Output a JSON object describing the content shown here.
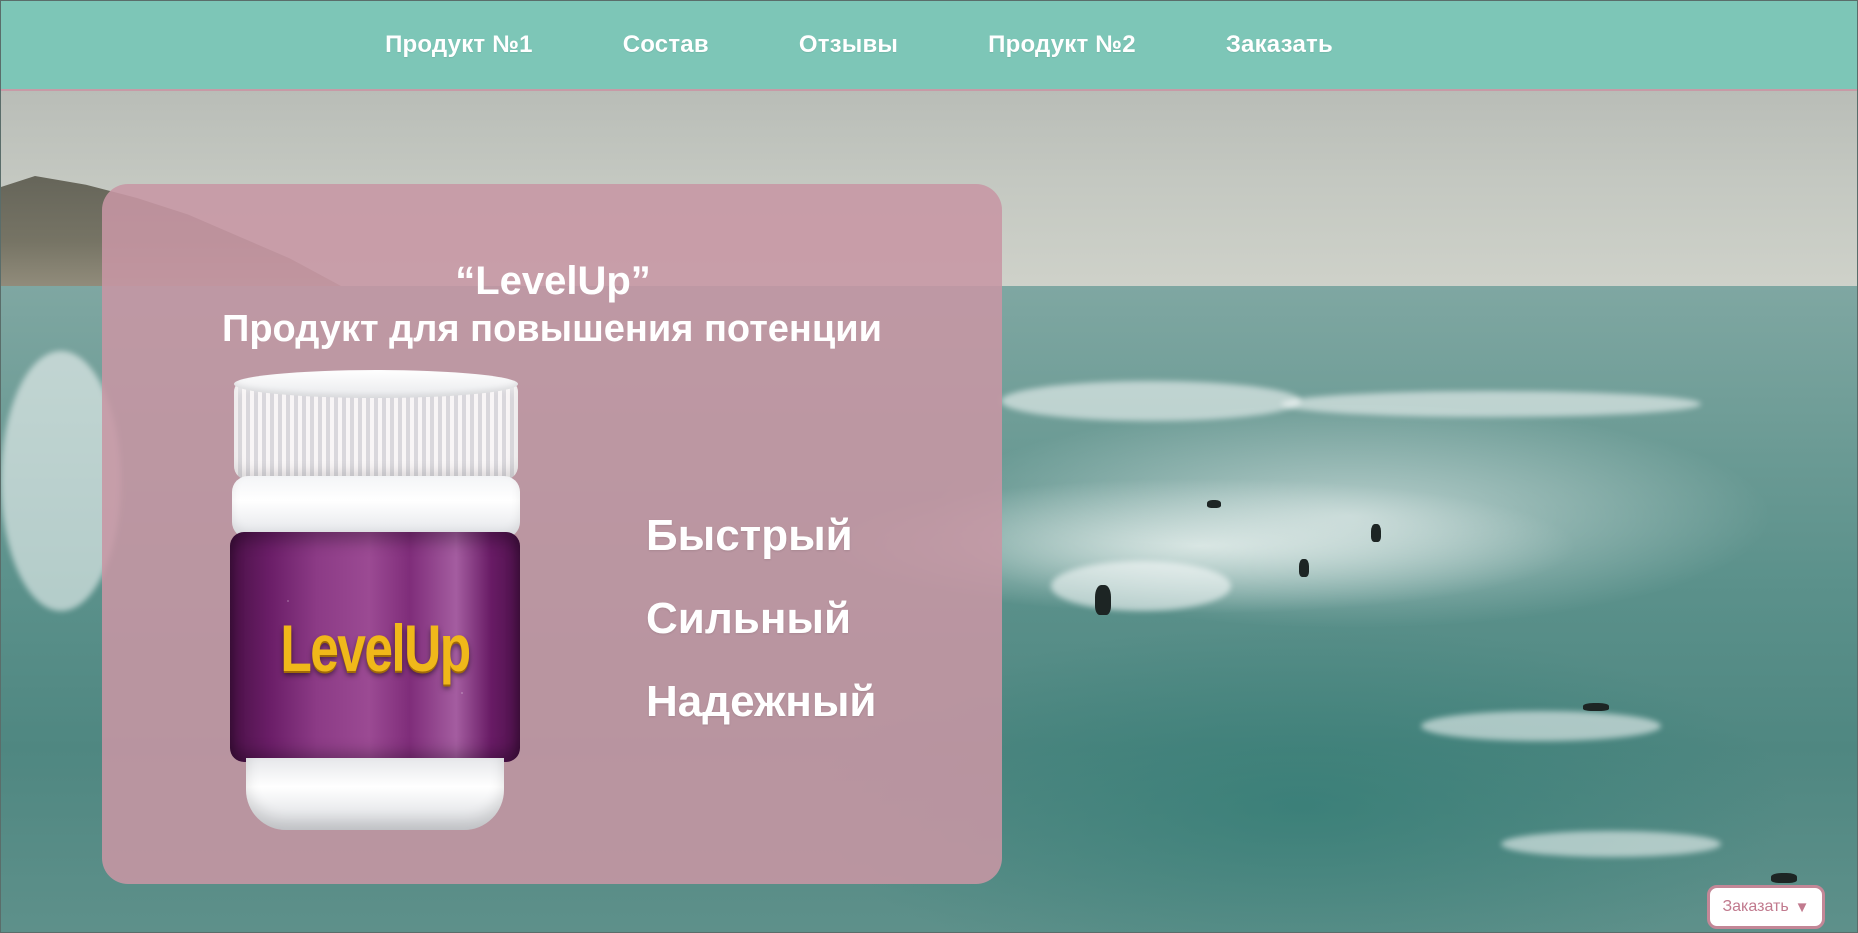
{
  "nav": {
    "items": [
      {
        "label": "Продукт №1"
      },
      {
        "label": "Состав"
      },
      {
        "label": "Отзывы"
      },
      {
        "label": "Продукт №2"
      },
      {
        "label": "Заказать"
      }
    ]
  },
  "hero": {
    "brand": "“LevelUp”",
    "subtitle": "Продукт для повышения потенции",
    "product_label": "LevelUp",
    "features": [
      {
        "label": "Быстрый"
      },
      {
        "label": "Сильный"
      },
      {
        "label": "Надежный"
      }
    ]
  },
  "order_button": {
    "label": "Заказать",
    "caret": "▼"
  },
  "colors": {
    "nav_bg": "#7dc6b7",
    "card_bg": "#c796a4",
    "accent": "#c38797",
    "label_gold": "#f0b81a",
    "jar_purple": "#8c3b86"
  }
}
